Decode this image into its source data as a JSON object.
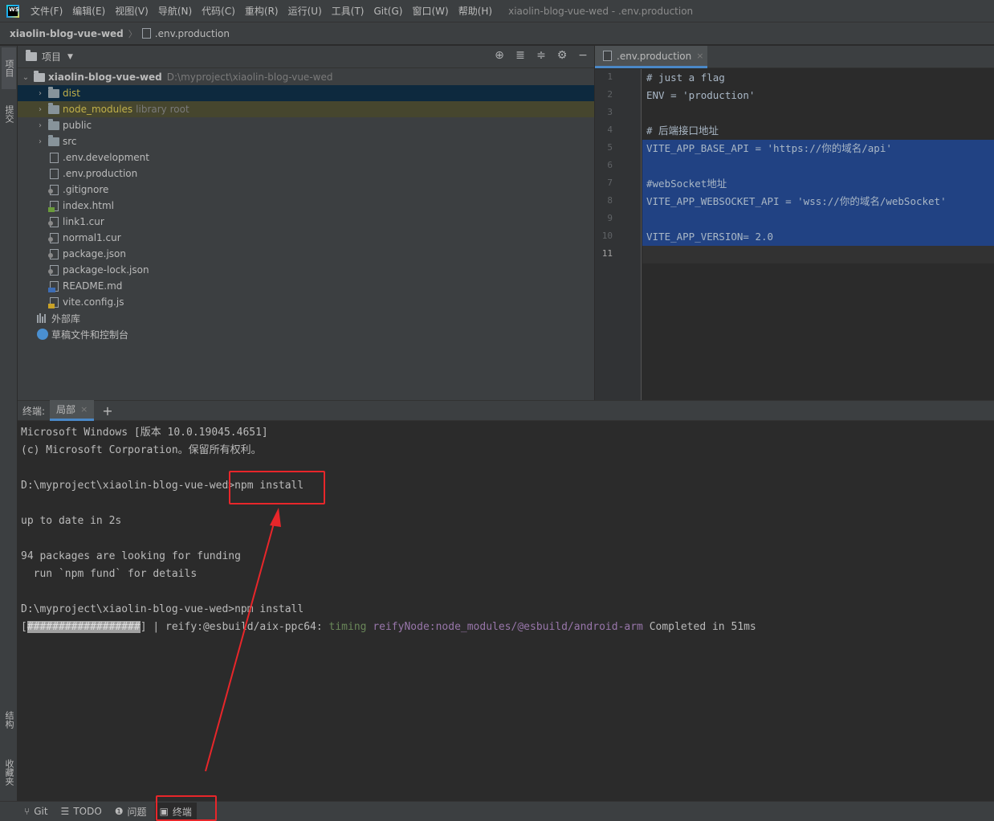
{
  "menubar": {
    "logo": "WS",
    "items": [
      "文件(F)",
      "编辑(E)",
      "视图(V)",
      "导航(N)",
      "代码(C)",
      "重构(R)",
      "运行(U)",
      "工具(T)",
      "Git(G)",
      "窗口(W)",
      "帮助(H)"
    ],
    "window_title": "xiaolin-blog-vue-wed - .env.production"
  },
  "breadcrumb": {
    "root": "xiaolin-blog-vue-wed",
    "file": ".env.production"
  },
  "left_strip": {
    "tabs": [
      "项目",
      "提交",
      "结构",
      "收藏夹"
    ]
  },
  "project_panel": {
    "title": "项目",
    "root_name": "xiaolin-blog-vue-wed",
    "root_path": "D:\\myproject\\xiaolin-blog-vue-wed",
    "folders": [
      "dist",
      "node_modules",
      "public",
      "src"
    ],
    "node_modules_note": "library root",
    "files": [
      ".env.development",
      ".env.production",
      ".gitignore",
      "index.html",
      "link1.cur",
      "normal1.cur",
      "package.json",
      "package-lock.json",
      "README.md",
      "vite.config.js"
    ],
    "external_libs": "外部库",
    "scratches": "草稿文件和控制台"
  },
  "editor": {
    "tab_name": ".env.production",
    "line_numbers": [
      "1",
      "2",
      "3",
      "4",
      "5",
      "6",
      "7",
      "8",
      "9",
      "10",
      "11"
    ],
    "lines": [
      "# just a flag",
      "ENV = 'production'",
      "",
      "# 后端接口地址",
      "VITE_APP_BASE_API = 'https://你的域名/api'",
      "",
      "#webSocket地址",
      "VITE_APP_WEBSOCKET_API = 'wss://你的域名/webSocket'",
      "",
      "VITE_APP_VERSION= 2.0",
      ""
    ]
  },
  "terminal": {
    "label": "终端:",
    "tab": "局部",
    "add": "+",
    "lines": {
      "l1": "Microsoft Windows [版本 10.0.19045.4651]",
      "l2": "(c) Microsoft Corporation。保留所有权利。",
      "l3": "D:\\myproject\\xiaolin-blog-vue-wed>npm install",
      "l4": "up to date in 2s",
      "l5": "94 packages are looking for funding",
      "l6": "  run `npm fund` for details",
      "l7": "D:\\myproject\\xiaolin-blog-vue-wed>npm install",
      "progress_open": "[",
      "progress_fill": "##################",
      "progress_close": "] | reify:@esbuild/aix-ppc64: ",
      "progress_timing": "timing",
      "progress_node": " reifyNode:node_modules/@esbuild/android-arm",
      "progress_done": " Completed in 51ms"
    }
  },
  "statusbar": {
    "git": "Git",
    "todo": "TODO",
    "problems": "问题",
    "terminal": "终端"
  },
  "annotation_color": "#e8262a"
}
